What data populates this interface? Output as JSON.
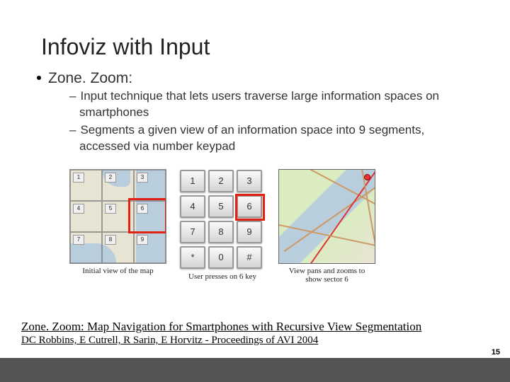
{
  "title": "Infoviz with Input",
  "bullets": {
    "l1": "Zone. Zoom:",
    "l2a": "Input technique that lets users traverse large information spaces on smartphones",
    "l2b": "Segments a given view of an information space into 9 segments, accessed via number keypad"
  },
  "figures": {
    "initialMap": {
      "caption": "Initial view of the map",
      "cells": [
        "1",
        "2",
        "3",
        "4",
        "5",
        "6",
        "7",
        "8",
        "9"
      ],
      "highlightIndex": 5
    },
    "keypad": {
      "caption": "User presses on 6 key",
      "keys": [
        "1",
        "2",
        "3",
        "4",
        "5",
        "6",
        "7",
        "8",
        "9",
        "*",
        "0",
        "#"
      ],
      "highlightKey": "6"
    },
    "zoomedMap": {
      "caption": "View pans and zooms to show sector 6"
    }
  },
  "citation": {
    "line1": "Zone. Zoom: Map Navigation for Smartphones with Recursive View Segmentation",
    "line2": "DC Robbins, E Cutrell, R Sarin, E Horvitz - Proceedings of AVI 2004"
  },
  "pageNumber": "15"
}
